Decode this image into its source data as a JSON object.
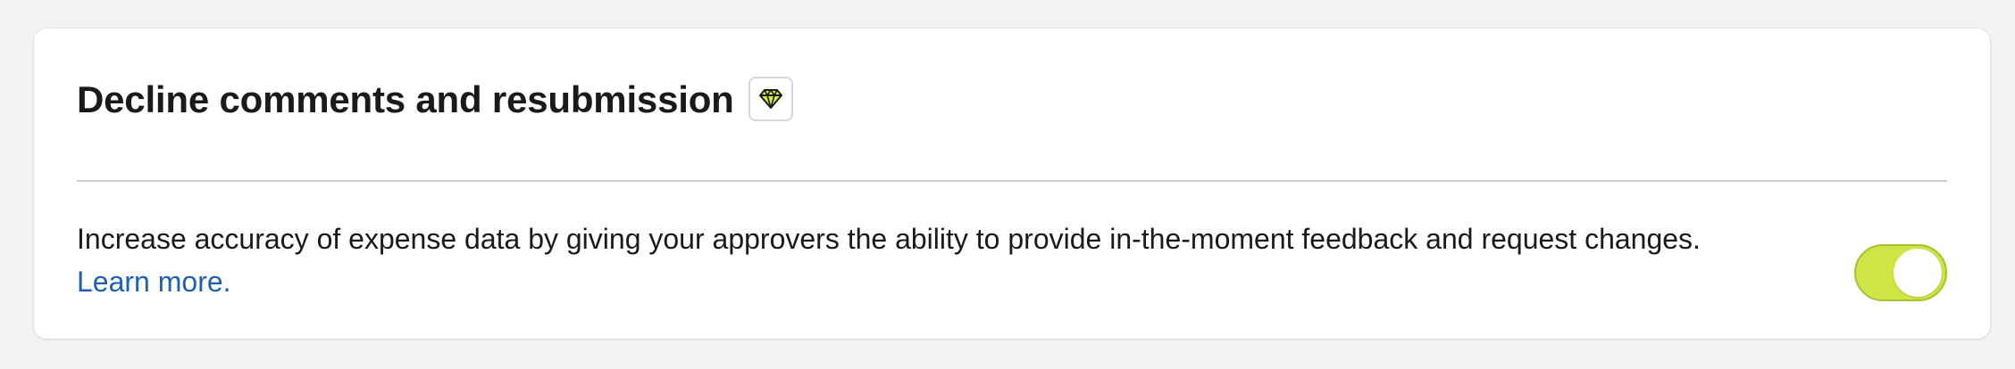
{
  "section": {
    "title": "Decline comments and resubmission",
    "badge_icon": "diamond-icon",
    "description": "Increase accuracy of expense data by giving your approvers the ability to provide in-the-moment feedback and request changes.",
    "learn_more": "Learn more.",
    "toggle": {
      "state": "on",
      "on_color": "#cfe545"
    }
  }
}
